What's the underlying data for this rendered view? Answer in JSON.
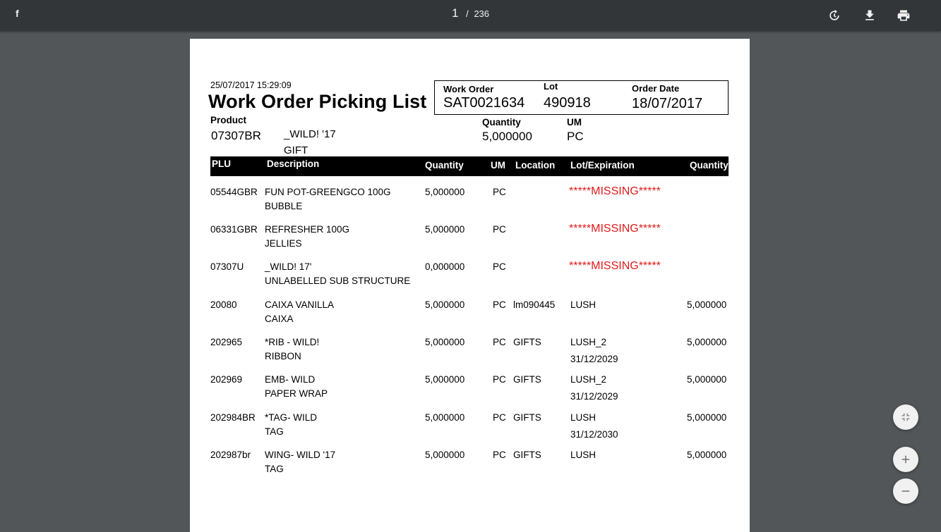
{
  "toolbar": {
    "title": "f",
    "current_page": "1",
    "page_separator": "/",
    "total_pages": "236",
    "icons": [
      "rotate-icon",
      "download-icon",
      "print-icon"
    ]
  },
  "report": {
    "timestamp": "25/07/2017 15:29:09",
    "title": "Work Order Picking List",
    "work_order_label": "Work Order",
    "work_order": "SAT0021634",
    "lot_label": "Lot",
    "lot": "490918",
    "order_date_label": "Order Date",
    "order_date": "18/07/2017",
    "product_label": "Product",
    "product_code": "07307BR",
    "product_desc_1": "_WILD! '17",
    "product_desc_2": "GIFT",
    "quantity_label": "Quantity",
    "quantity": "5,000000",
    "um_label": "UM",
    "um": "PC"
  },
  "table": {
    "headers": {
      "plu": "PLU",
      "description": "Description",
      "quantity": "Quantity",
      "um": "UM",
      "location": "Location",
      "lot_expiration": "Lot/Expiration",
      "quantity2": "Quantity"
    },
    "rows": [
      {
        "plu": "05544GBR",
        "desc1": "FUN POT-GREENGCO 100G",
        "desc2": "BUBBLE",
        "qty": "5,000000",
        "um": "PC",
        "location": "",
        "lot": "*****MISSING*****",
        "expiration": "",
        "qty2": "",
        "missing": true
      },
      {
        "plu": "06331GBR",
        "desc1": "REFRESHER 100G",
        "desc2": "JELLIES",
        "qty": "5,000000",
        "um": "PC",
        "location": "",
        "lot": "*****MISSING*****",
        "expiration": "",
        "qty2": "",
        "missing": true
      },
      {
        "plu": "07307U",
        "desc1": "_WILD! 17'",
        "desc2": "UNLABELLED SUB STRUCTURE",
        "qty": "0,000000",
        "um": "PC",
        "location": "",
        "lot": "*****MISSING*****",
        "expiration": "",
        "qty2": "",
        "missing": true
      },
      {
        "plu": "20080",
        "desc1": "CAIXA VANILLA",
        "desc2": "CAIXA",
        "qty": "5,000000",
        "um": "PC",
        "location": "lm090445",
        "lot": "LUSH",
        "expiration": "",
        "qty2": "5,000000",
        "missing": false
      },
      {
        "plu": "202965",
        "desc1": "*RIB - WILD!",
        "desc2": "RIBBON",
        "qty": "5,000000",
        "um": "PC",
        "location": "GIFTS",
        "lot": "LUSH_2",
        "expiration": "31/12/2029",
        "qty2": "5,000000",
        "missing": false
      },
      {
        "plu": "202969",
        "desc1": "EMB- WILD",
        "desc2": "PAPER WRAP",
        "qty": "5,000000",
        "um": "PC",
        "location": "GIFTS",
        "lot": "LUSH_2",
        "expiration": "31/12/2029",
        "qty2": "5,000000",
        "missing": false
      },
      {
        "plu": "202984BR",
        "desc1": "*TAG- WILD",
        "desc2": "TAG",
        "qty": "5,000000",
        "um": "PC",
        "location": "GIFTS",
        "lot": "LUSH",
        "expiration": "31/12/2030",
        "qty2": "5,000000",
        "missing": false
      },
      {
        "plu": "202987br",
        "desc1": "WING- WILD '17",
        "desc2": "TAG",
        "qty": "5,000000",
        "um": "PC",
        "location": "GIFTS",
        "lot": "LUSH",
        "expiration": "",
        "qty2": "5,000000",
        "missing": false
      }
    ]
  },
  "controls": {
    "icons": [
      "fit-to-page-icon",
      "zoom-in-icon",
      "zoom-out-icon"
    ]
  },
  "colors": {
    "toolbar_bg": "#323639",
    "viewer_bg": "#525659",
    "missing_text": "#e21a1a"
  }
}
